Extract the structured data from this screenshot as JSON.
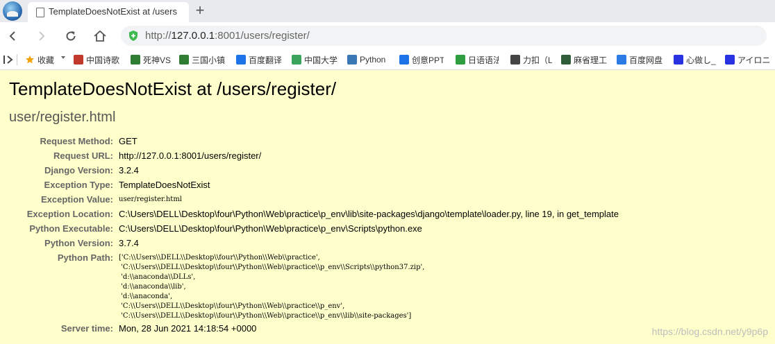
{
  "browser": {
    "tab_title": "TemplateDoesNotExist at /users",
    "address": {
      "prefix": "http://",
      "host": "127.0.0.1",
      "rest": ":8001/users/register/"
    },
    "bookmarks": [
      {
        "label": "收藏",
        "icon": "star-icon",
        "color": "#f0a30a"
      },
      {
        "label": "中国诗歌",
        "icon": "poetry-icon",
        "color": "#c0392b"
      },
      {
        "label": "死神VS",
        "icon": "grid-icon",
        "color": "#2e7d32"
      },
      {
        "label": "三国小镇",
        "icon": "grid-icon",
        "color": "#2e7d32"
      },
      {
        "label": "百度翻译",
        "icon": "translate-icon",
        "color": "#1e73e8"
      },
      {
        "label": "中国大学",
        "icon": "mooc-icon",
        "color": "#3aa35c"
      },
      {
        "label": "Python",
        "icon": "python-icon",
        "color": "#3a78b5"
      },
      {
        "label": "创意PPT",
        "icon": "ppt-icon",
        "color": "#1e73e8"
      },
      {
        "label": "日语语法",
        "icon": "info-icon",
        "color": "#2e9e3e"
      },
      {
        "label": "力扣（L",
        "icon": "leetcode-icon",
        "color": "#444444"
      },
      {
        "label": "麻省理工",
        "icon": "play-icon",
        "color": "#2f5d3a"
      },
      {
        "label": "百度网盘",
        "icon": "cloud-icon",
        "color": "#2c7be5"
      },
      {
        "label": "心做し_",
        "icon": "paw-icon",
        "color": "#2932e1"
      },
      {
        "label": "アイロニ",
        "icon": "paw-icon",
        "color": "#2932e1"
      }
    ]
  },
  "error": {
    "title": "TemplateDoesNotExist at /users/register/",
    "subtitle": "user/register.html",
    "fields": {
      "request_method": {
        "label": "Request Method:",
        "value": "GET"
      },
      "request_url": {
        "label": "Request URL:",
        "value": "http://127.0.0.1:8001/users/register/"
      },
      "django_version": {
        "label": "Django Version:",
        "value": "3.2.4"
      },
      "exception_type": {
        "label": "Exception Type:",
        "value": "TemplateDoesNotExist"
      },
      "exception_value": {
        "label": "Exception Value:",
        "value": "user/register.html"
      },
      "exception_location": {
        "label": "Exception Location:",
        "value": "C:\\Users\\DELL\\Desktop\\four\\Python\\Web\\practice\\p_env\\lib\\site-packages\\django\\template\\loader.py, line 19, in get_template"
      },
      "python_executable": {
        "label": "Python Executable:",
        "value": "C:\\Users\\DELL\\Desktop\\four\\Python\\Web\\practice\\p_env\\Scripts\\python.exe"
      },
      "python_version": {
        "label": "Python Version:",
        "value": "3.7.4"
      },
      "python_path": {
        "label": "Python Path:",
        "lines": [
          "['C:\\\\Users\\\\DELL\\\\Desktop\\\\four\\\\Python\\\\Web\\\\practice',",
          " 'C:\\\\Users\\\\DELL\\\\Desktop\\\\four\\\\Python\\\\Web\\\\practice\\\\p_env\\\\Scripts\\\\python37.zip',",
          " 'd:\\\\anaconda\\\\DLLs',",
          " 'd:\\\\anaconda\\\\lib',",
          " 'd:\\\\anaconda',",
          " 'C:\\\\Users\\\\DELL\\\\Desktop\\\\four\\\\Python\\\\Web\\\\practice\\\\p_env',",
          " 'C:\\\\Users\\\\DELL\\\\Desktop\\\\four\\\\Python\\\\Web\\\\practice\\\\p_env\\\\lib\\\\site-packages']"
        ]
      },
      "server_time": {
        "label": "Server time:",
        "value": "Mon, 28 Jun 2021 14:18:54 +0000"
      }
    }
  },
  "watermark": "https://blog.csdn.net/y9p6p"
}
